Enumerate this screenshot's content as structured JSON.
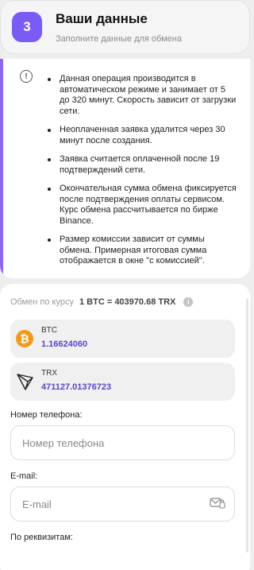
{
  "step": {
    "number": "3",
    "title": "Ваши данные",
    "subtitle": "Заполните данные для обмена"
  },
  "info": {
    "icon": "!",
    "notes": [
      "Данная операция производится в автоматическом режиме и занимает от 5 до 320 минут. Скорость зависит от загрузки сети.",
      "Неоплаченная заявка удалится через 30 минут после создания.",
      "Заявка считается оплаченной после 19 подтверждений сети.",
      "Окончательная сумма обмена фиксируется после подтверждения оплаты сервисом. Курс обмена рассчитывается по бирже Binance.",
      "Размер комиссии зависит от суммы обмена. Примерная итоговая сумма отображается в окне \"с комиссией\"."
    ]
  },
  "exchange": {
    "rate_label": "Обмен по курсу",
    "rate_value": "1 BTC = 403970.68 TRX",
    "rate_info_icon": "i",
    "from": {
      "currency": "BTC",
      "amount": "1.16624060",
      "icon": "bitcoin-icon"
    },
    "to": {
      "currency": "TRX",
      "amount": "471127.01376723",
      "icon": "tron-icon"
    }
  },
  "form": {
    "phone_label": "Номер телефона:",
    "phone_placeholder": "Номер телефона",
    "email_label": "E-mail:",
    "email_placeholder": "E-mail",
    "requisites_label": "По реквизитам:"
  },
  "colors": {
    "accent": "#7a5cf5",
    "amount": "#5e43c9",
    "bitcoin": "#f3991f"
  }
}
